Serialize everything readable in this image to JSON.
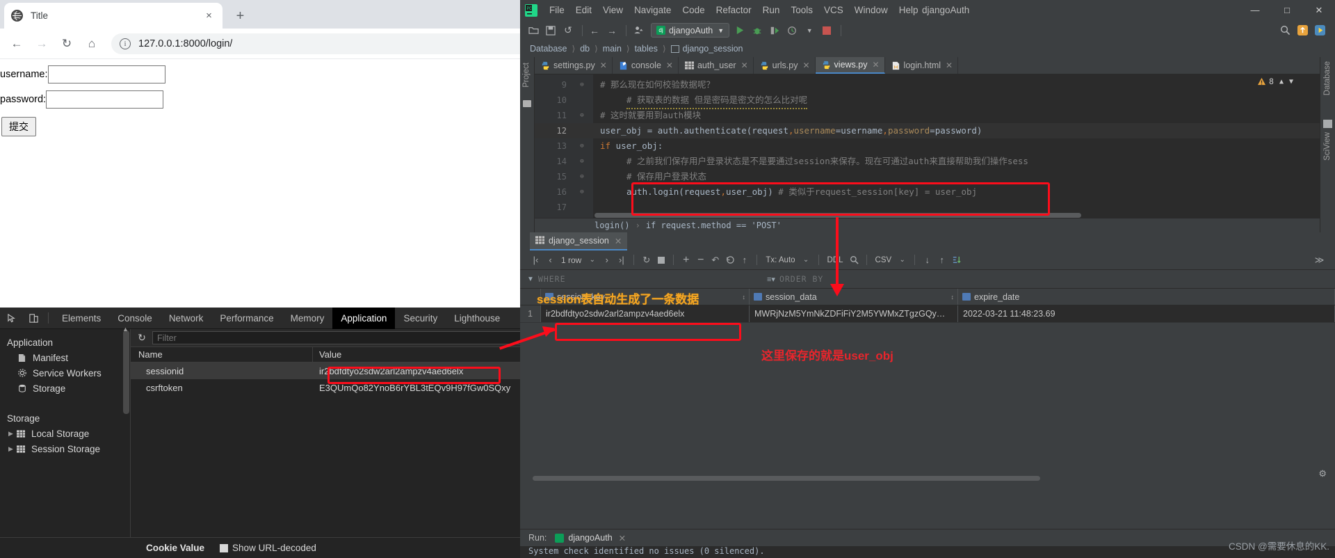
{
  "browser": {
    "tab": {
      "title": "Title",
      "favicon": "globe-icon",
      "close": "×"
    },
    "new_tab": "+",
    "nav": {
      "back": "←",
      "forward": "→",
      "reload": "↻",
      "home": "⌂"
    },
    "omnibox": {
      "info_icon": "i",
      "url": "127.0.0.1:8000/login/"
    },
    "page": {
      "username_label": "username:",
      "username_value": "",
      "password_label": "password:",
      "password_value": "",
      "submit_label": "提交"
    }
  },
  "devtools": {
    "tabs": [
      {
        "label": "Elements",
        "active": false
      },
      {
        "label": "Console",
        "active": false
      },
      {
        "label": "Network",
        "active": false
      },
      {
        "label": "Performance",
        "active": false
      },
      {
        "label": "Memory",
        "active": false
      },
      {
        "label": "Application",
        "active": true
      },
      {
        "label": "Security",
        "active": false
      },
      {
        "label": "Lighthouse",
        "active": false
      }
    ],
    "sidebar": {
      "section_application": "Application",
      "items": [
        {
          "label": "Manifest",
          "icon": "document-icon"
        },
        {
          "label": "Service Workers",
          "icon": "gear-icon"
        },
        {
          "label": "Storage",
          "icon": "database-icon"
        }
      ],
      "section_storage": "Storage",
      "storage_items": [
        {
          "label": "Local Storage",
          "icon": "table-icon",
          "arrow": "▶"
        },
        {
          "label": "Session Storage",
          "icon": "table-icon",
          "arrow": "▶"
        }
      ]
    },
    "filter": {
      "placeholder": "Filter",
      "value": "",
      "refresh_icon": "refresh-icon"
    },
    "cookie_table": {
      "columns": [
        "Name",
        "Value"
      ],
      "rows": [
        {
          "name": "sessionid",
          "value": "ir2bdfdtyo2sdw2arl2ampzv4aed6elx",
          "selected": true
        },
        {
          "name": "csrftoken",
          "value": "E3QUmQo82YnoB6rYBL3tEQv9H97fGw0SQxy",
          "selected": false
        }
      ]
    },
    "cookie_value_bar": {
      "label": "Cookie Value",
      "show_url_decoded": "Show URL-decoded"
    }
  },
  "ide": {
    "logo": "pycharm-logo",
    "menu": [
      "File",
      "Edit",
      "View",
      "Navigate",
      "Code",
      "Refactor",
      "Run",
      "Tools",
      "VCS",
      "Window",
      "Help"
    ],
    "project_name": "djangoAuth",
    "window_buttons": {
      "minimize": "—",
      "maximize": "□",
      "close": "✕"
    },
    "toolbar": {
      "open_icon": "open-folder-icon",
      "save_icon": "save-icon",
      "sync_icon": "sync-icon",
      "back_icon": "back-arrow-icon",
      "forward_icon": "forward-arrow-icon",
      "profile_icon": "user-icon",
      "run_config": "djangoAuth",
      "run_icon": "run-icon",
      "debug_icon": "debug-icon",
      "coverage_icon": "coverage-icon",
      "profile_run_icon": "profile-run-icon",
      "stop_icon": "stop-icon",
      "search_icon": "search-icon",
      "update_icon": "update-icon",
      "play_icon": "play-icon"
    },
    "breadcrumb": [
      "Database",
      "db",
      "main",
      "tables",
      "django_session"
    ],
    "left_strip": "Project",
    "right_strips": [
      "Database",
      "SciView"
    ],
    "editor_tabs": [
      {
        "label": "settings.py",
        "icon": "python-icon",
        "active": false
      },
      {
        "label": "console",
        "icon": "console-icon",
        "active": false
      },
      {
        "label": "auth_user",
        "icon": "table-icon",
        "active": false
      },
      {
        "label": "urls.py",
        "icon": "python-icon",
        "active": false
      },
      {
        "label": "views.py",
        "icon": "python-icon",
        "active": true
      },
      {
        "label": "login.html",
        "icon": "html-icon",
        "active": false
      }
    ],
    "warning_count": "8",
    "code_lines": [
      {
        "num": "9",
        "fold": "⊖",
        "indent": 0,
        "segments": [
          {
            "cls": "c-com",
            "t": "# 那么现在如何校验数据呢？"
          }
        ]
      },
      {
        "num": "10",
        "fold": "",
        "indent": 1,
        "segments": [
          {
            "cls": "c-com squiggle",
            "t": "# 获取表的数据  但是密码是密文的怎么比对呢"
          }
        ]
      },
      {
        "num": "11",
        "fold": "⊖",
        "indent": 0,
        "segments": [
          {
            "cls": "c-com",
            "t": "# 这时就要用到auth模块"
          }
        ]
      },
      {
        "num": "12",
        "fold": "",
        "indent": 0,
        "cur": true,
        "segments": [
          {
            "cls": "c-id",
            "t": "user_obj = auth.authenticate(request"
          },
          {
            "cls": "c-kw",
            "t": ","
          },
          {
            "cls": "c-namedarg",
            "t": "username"
          },
          {
            "cls": "c-id",
            "t": "=username"
          },
          {
            "cls": "c-kw",
            "t": ","
          },
          {
            "cls": "c-namedarg",
            "t": "password"
          },
          {
            "cls": "c-id",
            "t": "=password)"
          }
        ]
      },
      {
        "num": "13",
        "fold": "⊖",
        "indent": 0,
        "segments": [
          {
            "cls": "c-kw",
            "t": "if "
          },
          {
            "cls": "c-id",
            "t": "user_obj:"
          }
        ]
      },
      {
        "num": "14",
        "fold": "⊖",
        "indent": 1,
        "segments": [
          {
            "cls": "c-com",
            "t": "# 之前我们保存用户登录状态是不是要通过session来保存。现在可通过auth来直接帮助我们操作sess"
          }
        ]
      },
      {
        "num": "15",
        "fold": "⊖",
        "indent": 1,
        "segments": [
          {
            "cls": "c-com",
            "t": "# 保存用户登录状态"
          }
        ]
      },
      {
        "num": "16",
        "fold": "⊖",
        "indent": 1,
        "highlight": true,
        "segments": [
          {
            "cls": "c-id",
            "t": "auth.login(request"
          },
          {
            "cls": "c-kw",
            "t": ","
          },
          {
            "cls": "c-id",
            "t": "user_obj)"
          },
          {
            "cls": "c-com",
            "t": "  # 类似于request_session[key] = user_obj"
          }
        ]
      },
      {
        "num": "17",
        "fold": "",
        "indent": 0,
        "segments": []
      }
    ],
    "status_line": {
      "scope": "login()",
      "sep": "›",
      "condition": "if request.method == 'POST'"
    },
    "db": {
      "tab": {
        "label": "django_session",
        "icon": "table-icon",
        "close": "✕"
      },
      "toolbar": {
        "first_icon": "|‹",
        "prev_icon": "‹",
        "row_count": "1 row",
        "row_count_caret": "⌄",
        "next_icon": "›",
        "last_icon": "›|",
        "refresh_icon": "refresh-icon",
        "stop_icon": "stop-icon",
        "add_icon": "+",
        "remove_icon": "−",
        "revert_icon": "↶",
        "revert_all_icon": "revert-all-icon",
        "submit_icon": "↑",
        "tx_label": "Tx: Auto",
        "tx_caret": "⌄",
        "ddl_label": "DDL",
        "search_icon": "search-icon",
        "csv_label": "CSV",
        "csv_caret": "⌄",
        "download_icon": "↓",
        "upload_icon": "↑",
        "compare_icon": "compare-icon",
        "overflow_icon": "≫"
      },
      "filter_row": {
        "where_label": "WHERE",
        "order_by_label": "ORDER BY",
        "order_icon": "order-icon"
      },
      "columns": [
        "session_key",
        "session_data",
        "expire_date"
      ],
      "rows": [
        {
          "index": "1",
          "session_key": "ir2bdfdtyo2sdw2arl2ampzv4aed6elx",
          "session_data": "MWRjNzM5YmNkZDFiFiY2M5YWMxZTgzGQy…",
          "expire_date": "2022-03-21 11:48:23.69"
        }
      ],
      "annotations": {
        "session_table_note": "session表自动生成了一条数据",
        "user_obj_note": "这里保存的就是user_obj"
      }
    },
    "run_panel": {
      "run_label": "Run:",
      "config_name": "djangoAuth",
      "close_icon": "✕",
      "console_text": "System check identified no issues (0 silenced)."
    },
    "watermark": "CSDN @需要休息的KK."
  },
  "colors": {
    "red_highlight": "#fc0d1b",
    "orange_annotation": "#f5a623",
    "ide_bg": "#3c3f41",
    "editor_bg": "#2b2b2b",
    "devtools_bg": "#242424",
    "accent_blue": "#4a88c7"
  }
}
